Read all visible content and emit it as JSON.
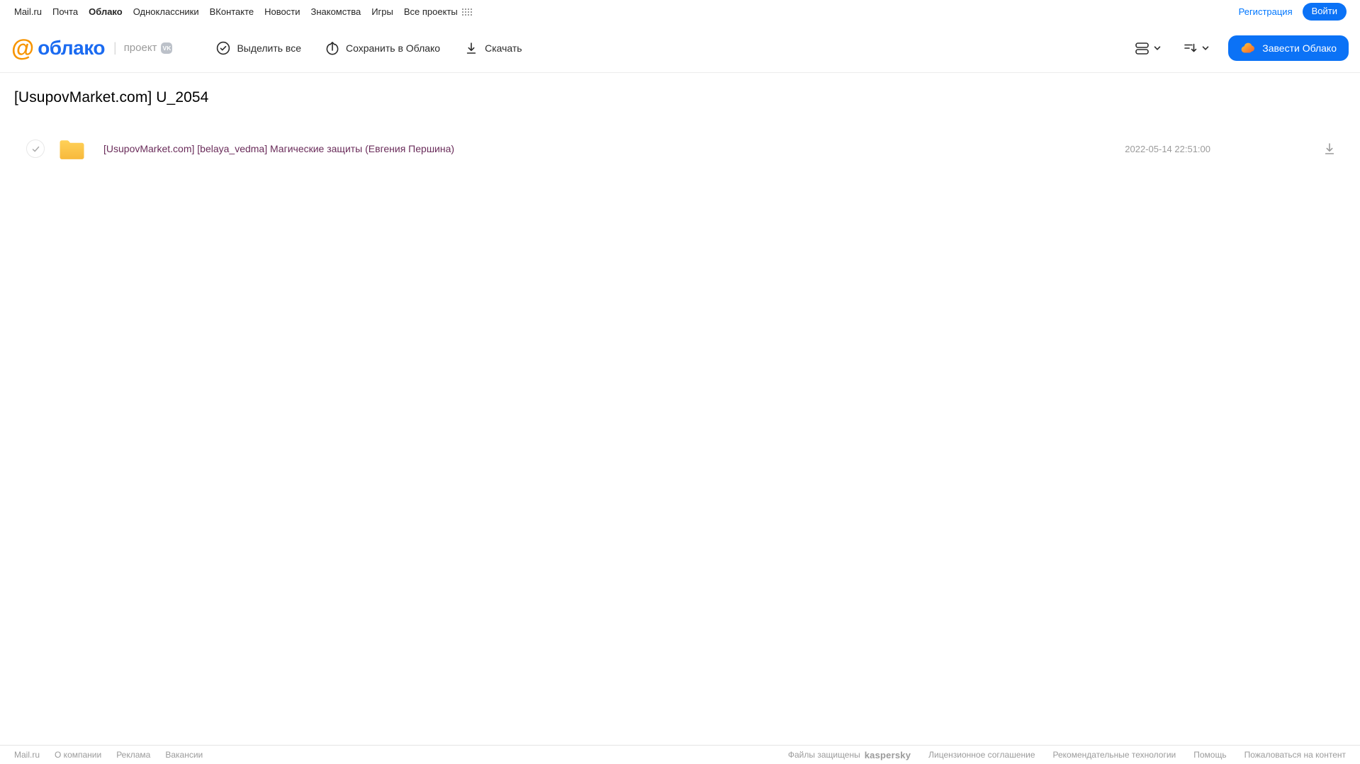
{
  "topnav": {
    "links": [
      "Mail.ru",
      "Почта",
      "Облако",
      "Одноклассники",
      "ВКонтакте",
      "Новости",
      "Знакомства",
      "Игры",
      "Все проекты"
    ],
    "registration": "Регистрация",
    "login": "Войти"
  },
  "header": {
    "logo_at": "@",
    "logo_text": "облако",
    "project_label": "проект",
    "vk_badge": "VK",
    "toolbar": {
      "select_all": "Выделить все",
      "save_to_cloud": "Сохранить в Облако",
      "download": "Скачать"
    },
    "get_cloud_button": "Завести Облако"
  },
  "main": {
    "title": "[UsupovMarket.com] U_2054",
    "files": [
      {
        "type": "folder",
        "name": "[UsupovMarket.com] [belaya_vedma] Магические защиты (Евгения Першина)",
        "date": "2022-05-14 22:51:00"
      }
    ]
  },
  "footer": {
    "left": [
      "Mail.ru",
      "О компании",
      "Реклама",
      "Вакансии"
    ],
    "protected_label": "Файлы защищены",
    "kaspersky": "kaspersky",
    "right": [
      "Лицензионное соглашение",
      "Рекомендательные технологии",
      "Помощь",
      "Пожаловаться на контент"
    ]
  },
  "colors": {
    "accent_blue": "#0b72f6",
    "link_blue": "#0077FF",
    "logo_orange": "#F79400",
    "logo_blue": "#1b6bf1",
    "folder_yellow": "#F8BC40",
    "visited_link": "#6a2c5a",
    "kaspersky_teal": "#00A88E",
    "muted_gray": "#9b9b9b"
  }
}
